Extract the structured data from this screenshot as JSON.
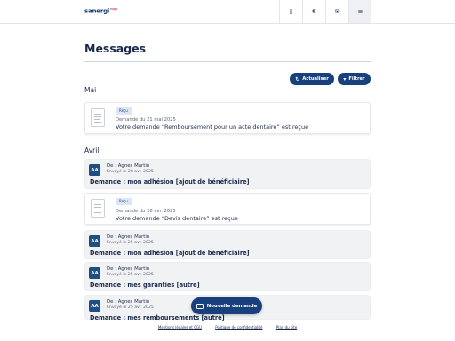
{
  "header": {
    "logo_text": "sanergi",
    "logo_sup": "mgp",
    "icons": [
      "card-icon",
      "euro-icon",
      "mail-icon",
      "menu-icon"
    ]
  },
  "page": {
    "title": "Messages"
  },
  "actions": {
    "refresh_label": "Actualiser",
    "filter_label": "Filtrer"
  },
  "sections": [
    {
      "label": "Mai",
      "items": [
        {
          "type": "document",
          "badge": "Reçu",
          "meta": "Demande du 21 mai 2025",
          "subject": "Votre demande “Remboursement pour un acte dentaire” est reçue"
        }
      ]
    },
    {
      "label": "Avril",
      "items": [
        {
          "type": "message",
          "initials": "AA",
          "from": "De : Agnes Martin",
          "sent": "Envoyé le 28 avr. 2025",
          "subject": "Demande : mon adhésion [ajout de bénéficiaire]"
        },
        {
          "type": "document",
          "badge": "Reçu",
          "meta": "Demande du 28 avr. 2025",
          "subject": "Votre demande “Devis dentaire” est reçue"
        },
        {
          "type": "message",
          "initials": "AA",
          "from": "De : Agnes Martin",
          "sent": "Envoyé le 25 avr. 2025",
          "subject": "Demande : mon adhésion [ajout de bénéficiaire]"
        },
        {
          "type": "message",
          "initials": "AA",
          "from": "De : Agnes Martin",
          "sent": "Envoyé le 25 avr. 2025",
          "subject": "Demande : mes garanties [autre]"
        },
        {
          "type": "message",
          "initials": "AA",
          "from": "De : Agnes Martin",
          "sent": "Envoyé le 25 avr. 2025",
          "subject": "Demande : mes remboursements [autre]"
        }
      ]
    }
  ],
  "fab": {
    "label": "Nouvelle demande"
  },
  "footer": {
    "links": [
      "Mentions légales et CGU",
      "Politique de confidentialité",
      "Plan du site"
    ]
  },
  "colors": {
    "primary": "#17407d",
    "avatar": "#1e4f83",
    "badge_bg": "#dde6f4",
    "logo_accent": "#e35a6a"
  }
}
